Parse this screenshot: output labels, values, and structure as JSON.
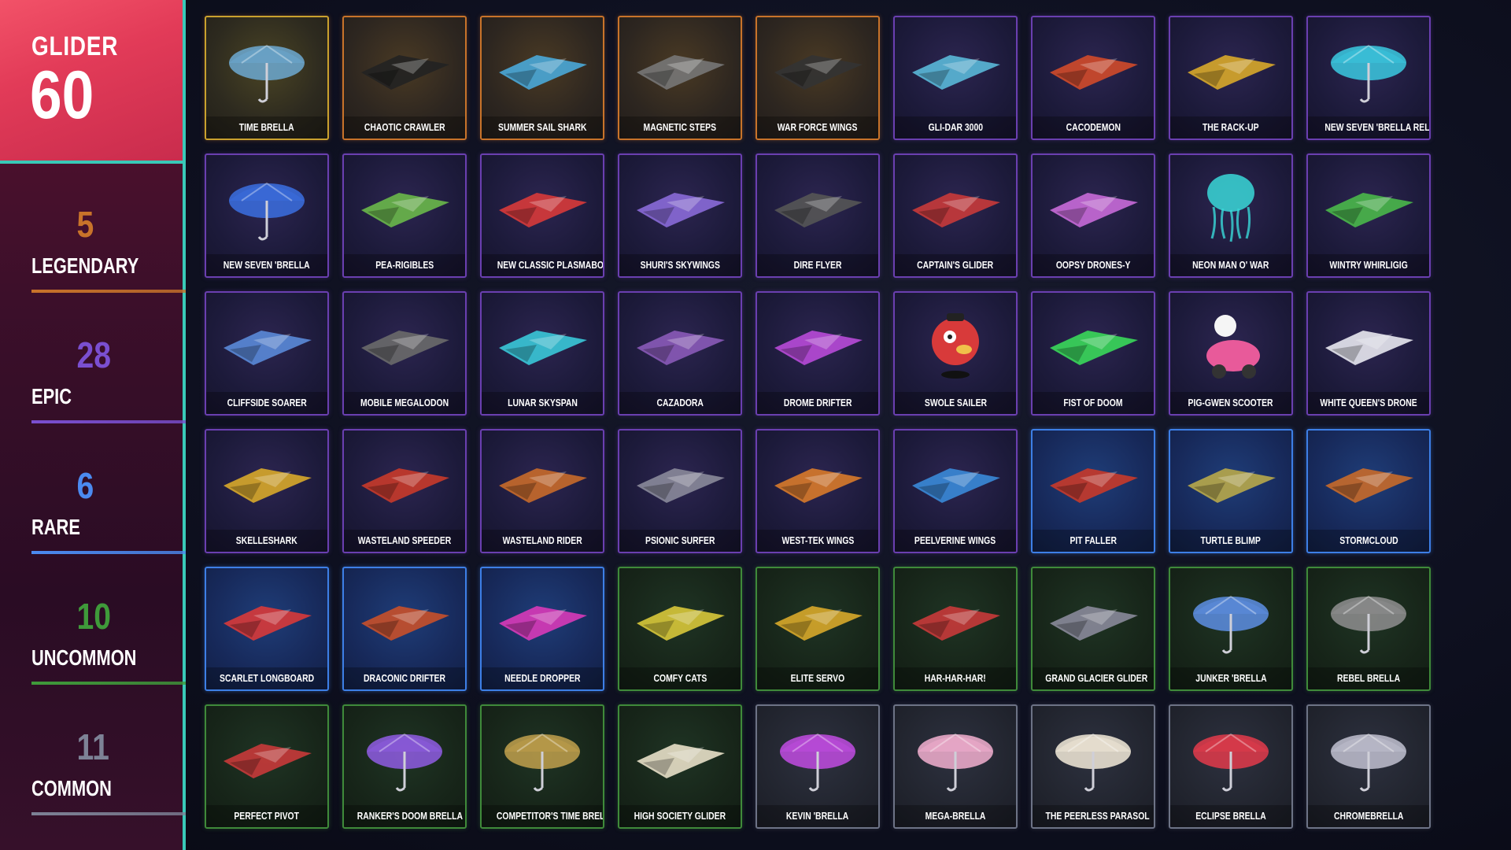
{
  "header": {
    "category": "GLIDER",
    "total": "60"
  },
  "rarities": [
    {
      "key": "legendary",
      "label": "LEGENDARY",
      "count": "5",
      "color": "#c8732a"
    },
    {
      "key": "epic",
      "label": "EPIC",
      "count": "28",
      "color": "#7a4fd0"
    },
    {
      "key": "rare",
      "label": "RARE",
      "count": "6",
      "color": "#4b8af0"
    },
    {
      "key": "uncommon",
      "label": "UNCOMMON",
      "count": "10",
      "color": "#3f9a3a"
    },
    {
      "key": "common",
      "label": "COMMON",
      "count": "11",
      "color": "#7d8296"
    }
  ],
  "items": [
    {
      "name": "TIME BRELLA",
      "rarity": "legendary",
      "variant": "gold",
      "icon": "umbrella-glider-icon",
      "accent": "#6aa3c8"
    },
    {
      "name": "CHAOTIC CRAWLER",
      "rarity": "legendary",
      "icon": "crawler-glider-icon",
      "accent": "#222"
    },
    {
      "name": "SUMMER SAIL SHARK",
      "rarity": "legendary",
      "icon": "shark-glider-icon",
      "accent": "#4aa8d8"
    },
    {
      "name": "MAGNETIC STEPS",
      "rarity": "legendary",
      "icon": "steps-glider-icon",
      "accent": "#777"
    },
    {
      "name": "WAR FORCE WINGS",
      "rarity": "legendary",
      "icon": "wings-glider-icon",
      "accent": "#333"
    },
    {
      "name": "GLI-DAR 3000",
      "rarity": "epic",
      "icon": "gli-dar-glider-icon",
      "accent": "#5ab8d8"
    },
    {
      "name": "CACODEMON",
      "rarity": "epic",
      "icon": "cacodemon-glider-icon",
      "accent": "#d04a2a"
    },
    {
      "name": "THE RACK-UP",
      "rarity": "epic",
      "icon": "rack-up-glider-icon",
      "accent": "#d8a82a"
    },
    {
      "name": "NEW SEVEN 'BRELLA RELOADED",
      "rarity": "epic",
      "icon": "umbrella-glider-icon",
      "accent": "#3ac0d8"
    },
    {
      "name": "NEW SEVEN 'BRELLA",
      "rarity": "epic",
      "icon": "umbrella-glider-icon",
      "accent": "#3a6ad8"
    },
    {
      "name": "PEA-RIGIBLES",
      "rarity": "epic",
      "icon": "pea-glider-icon",
      "accent": "#6ab84a"
    },
    {
      "name": "NEW CLASSIC PLASMABOARD",
      "rarity": "epic",
      "icon": "plasmaboard-glider-icon",
      "accent": "#d83a3a"
    },
    {
      "name": "SHURI'S SKYWINGS",
      "rarity": "epic",
      "icon": "skywings-glider-icon",
      "accent": "#8a6ad8"
    },
    {
      "name": "DIRE FLYER",
      "rarity": "epic",
      "icon": "dire-flyer-glider-icon",
      "accent": "#555"
    },
    {
      "name": "CAPTAIN'S GLIDER",
      "rarity": "epic",
      "icon": "captain-glider-icon",
      "accent": "#c83a3a"
    },
    {
      "name": "OOPSY DRONES-Y",
      "rarity": "epic",
      "icon": "drone-glider-icon",
      "accent": "#c86ad8"
    },
    {
      "name": "NEON MAN O' WAR",
      "rarity": "epic",
      "icon": "jellyfish-glider-icon",
      "accent": "#3ad8d8"
    },
    {
      "name": "WINTRY WHIRLIGIG",
      "rarity": "epic",
      "icon": "whirligig-glider-icon",
      "accent": "#4ab84a"
    },
    {
      "name": "CLIFFSIDE SOARER",
      "rarity": "epic",
      "icon": "soarer-glider-icon",
      "accent": "#5a8ad8"
    },
    {
      "name": "MOBILE MEGALODON",
      "rarity": "epic",
      "icon": "megalodon-glider-icon",
      "accent": "#6a6a6a"
    },
    {
      "name": "LUNAR SKYSPAN",
      "rarity": "epic",
      "icon": "skyspan-glider-icon",
      "accent": "#3ac8d8"
    },
    {
      "name": "CAZADORA",
      "rarity": "epic",
      "icon": "cazadora-glider-icon",
      "accent": "#8a5ab8"
    },
    {
      "name": "DROME DRIFTER",
      "rarity": "epic",
      "icon": "drifter-glider-icon",
      "accent": "#b84ad8"
    },
    {
      "name": "SWOLE SAILER",
      "rarity": "epic",
      "icon": "swole-glider-icon",
      "accent": "#d83a3a"
    },
    {
      "name": "FIST OF DOOM",
      "rarity": "epic",
      "icon": "fist-glider-icon",
      "accent": "#3ad85a"
    },
    {
      "name": "PIG-GWEN SCOOTER",
      "rarity": "epic",
      "icon": "scooter-glider-icon",
      "accent": "#e85a9a"
    },
    {
      "name": "WHITE QUEEN'S DRONE",
      "rarity": "epic",
      "icon": "queen-drone-glider-icon",
      "accent": "#e8e8f0"
    },
    {
      "name": "SKELLESHARK",
      "rarity": "epic",
      "icon": "skelleshark-glider-icon",
      "accent": "#d8a82a"
    },
    {
      "name": "WASTELAND SPEEDER",
      "rarity": "epic",
      "icon": "speeder-glider-icon",
      "accent": "#c83a2a"
    },
    {
      "name": "WASTELAND RIDER",
      "rarity": "epic",
      "icon": "rider-glider-icon",
      "accent": "#c86a2a"
    },
    {
      "name": "PSIONIC SURFER",
      "rarity": "epic",
      "icon": "surfer-glider-icon",
      "accent": "#8a8a9a"
    },
    {
      "name": "WEST-TEK WINGS",
      "rarity": "epic",
      "icon": "west-tek-glider-icon",
      "accent": "#d87a2a"
    },
    {
      "name": "PEELVERINE WINGS",
      "rarity": "epic",
      "icon": "peelverine-glider-icon",
      "accent": "#3a8ad8"
    },
    {
      "name": "PIT FALLER",
      "rarity": "rare",
      "icon": "pit-faller-glider-icon",
      "accent": "#c83a2a"
    },
    {
      "name": "TURTLE BLIMP",
      "rarity": "rare",
      "icon": "blimp-glider-icon",
      "accent": "#b8a84a"
    },
    {
      "name": "STORMCLOUD",
      "rarity": "rare",
      "icon": "stormcloud-glider-icon",
      "accent": "#c86a2a"
    },
    {
      "name": "SCARLET LONGBOARD",
      "rarity": "rare",
      "icon": "longboard-glider-icon",
      "accent": "#d83a3a"
    },
    {
      "name": "DRACONIC DRIFTER",
      "rarity": "rare",
      "icon": "draconic-glider-icon",
      "accent": "#c8502a"
    },
    {
      "name": "NEEDLE DROPPER",
      "rarity": "rare",
      "icon": "needle-glider-icon",
      "accent": "#d83ab8"
    },
    {
      "name": "COMFY CATS",
      "rarity": "uncommon",
      "icon": "cats-glider-icon",
      "accent": "#d8c83a"
    },
    {
      "name": "ELITE SERVO",
      "rarity": "uncommon",
      "icon": "servo-glider-icon",
      "accent": "#d8a82a"
    },
    {
      "name": "HAR-HAR-HAR!",
      "rarity": "uncommon",
      "icon": "har-glider-icon",
      "accent": "#c83a3a"
    },
    {
      "name": "GRAND GLACIER GLIDER",
      "rarity": "uncommon",
      "icon": "glacier-glider-icon",
      "accent": "#8a8a9a"
    },
    {
      "name": "JUNKER 'BRELLA",
      "rarity": "uncommon",
      "icon": "umbrella-glider-icon",
      "accent": "#5a8ad8"
    },
    {
      "name": "REBEL BRELLA",
      "rarity": "uncommon",
      "icon": "umbrella-glider-icon",
      "accent": "#8a8a8a"
    },
    {
      "name": "PERFECT PIVOT",
      "rarity": "uncommon",
      "icon": "pivot-glider-icon",
      "accent": "#c83a3a"
    },
    {
      "name": "RANKER'S DOOM BRELLA",
      "rarity": "uncommon",
      "icon": "umbrella-glider-icon",
      "accent": "#8a5ad8"
    },
    {
      "name": "COMPETITOR'S TIME BRELLA",
      "rarity": "uncommon",
      "icon": "umbrella-glider-icon",
      "accent": "#b89a4a"
    },
    {
      "name": "HIGH SOCIETY GLIDER",
      "rarity": "uncommon",
      "icon": "society-glider-icon",
      "accent": "#e8e0c8"
    },
    {
      "name": "KEVIN 'BRELLA",
      "rarity": "common",
      "icon": "umbrella-glider-icon",
      "accent": "#b84ad8"
    },
    {
      "name": "MEGA-BRELLA",
      "rarity": "common",
      "icon": "umbrella-glider-icon",
      "accent": "#e8a8c8"
    },
    {
      "name": "THE PEERLESS PARASOL",
      "rarity": "common",
      "icon": "umbrella-glider-icon",
      "accent": "#e8e0d0"
    },
    {
      "name": "ECLIPSE BRELLA",
      "rarity": "common",
      "icon": "umbrella-glider-icon",
      "accent": "#d83a4a"
    },
    {
      "name": "CHROMEBRELLA",
      "rarity": "common",
      "icon": "umbrella-glider-icon",
      "accent": "#b8b8c8"
    }
  ]
}
